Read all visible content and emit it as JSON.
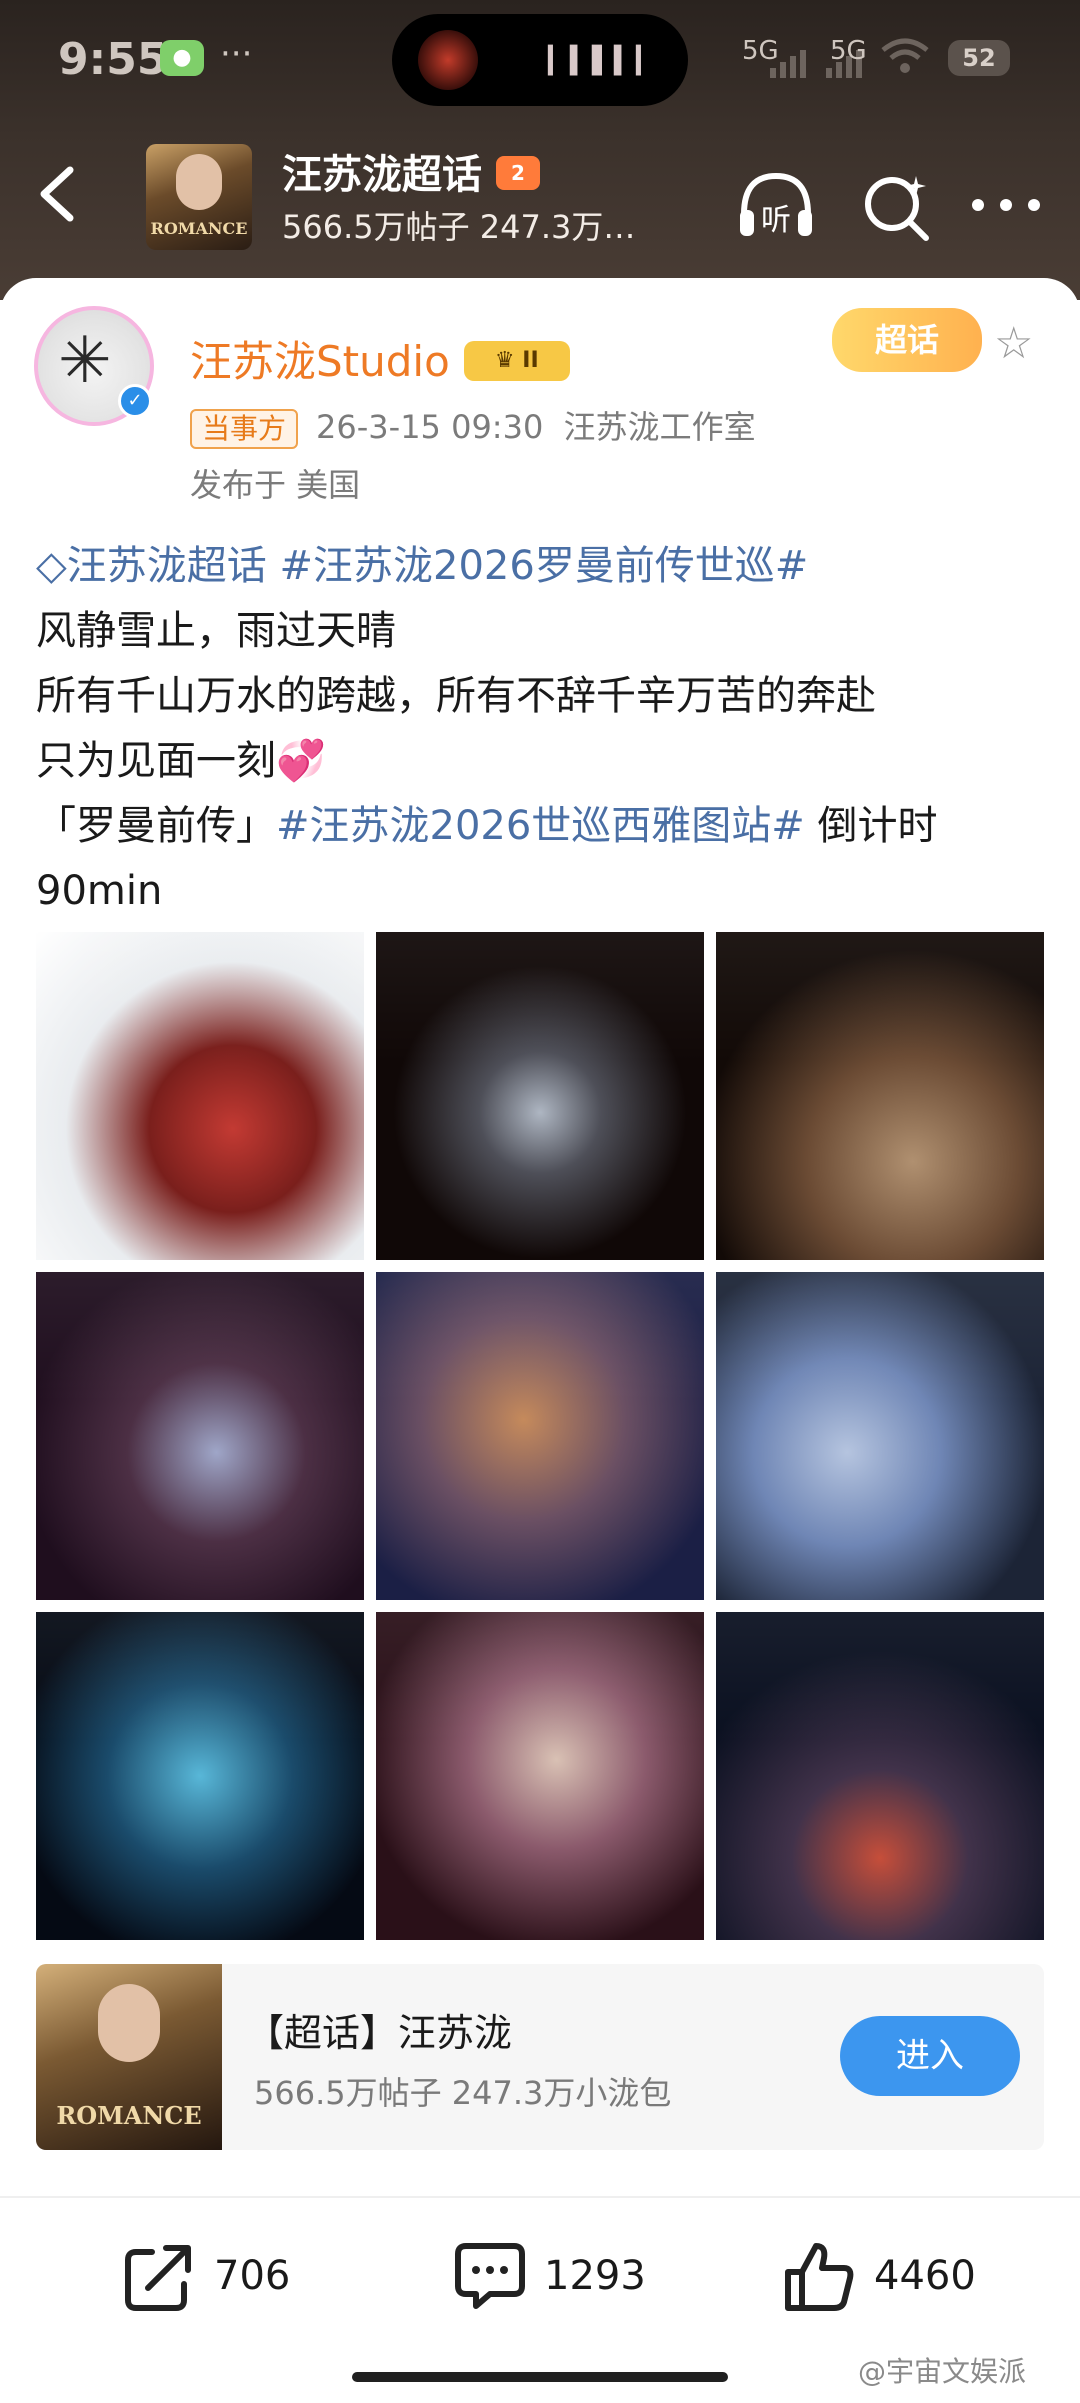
{
  "status_bar": {
    "time": "9:55",
    "dots": "···",
    "net1": "5G",
    "net2": "5G",
    "battery": "52"
  },
  "nav": {
    "title": "汪苏泷超话",
    "level": "2",
    "subtitle": "566.5万帖子 247.3万…",
    "listen_icon_text": "听",
    "avatar_logo": "ROMANCE"
  },
  "post": {
    "username": "汪苏泷Studio",
    "crown_label": "II",
    "supertopic_tag": "超话",
    "party_badge": "当事方",
    "timestamp": "26-3-15 09:30",
    "source": "汪苏泷工作室",
    "location": "发布于 美国",
    "line1_tag1": "汪苏泷超话",
    "line1_tag2": "#汪苏泷2026罗曼前传世巡#",
    "line2": "风静雪止，雨过天晴",
    "line3": "所有千山万水的跨越，所有不辞千辛万苦的奔赴",
    "line4": "只为见面一刻💞",
    "line5_pre": "「罗曼前传」",
    "line5_tag": "#汪苏泷2026世巡西雅图站#",
    "line5_post": " 倒计时",
    "line6": "90min"
  },
  "topic_card": {
    "title": "【超话】汪苏泷",
    "subtitle": "566.5万帖子 247.3万小泷包",
    "enter_label": "进入",
    "img_logo": "ROMANCE"
  },
  "actions": {
    "share_count": "706",
    "comment_count": "1293",
    "like_count": "4460"
  },
  "watermark": "@宇宙文娱派",
  "colors": {
    "username": "#ee7a25",
    "hashtag": "#4a6fa5",
    "enter_button": "#3c96ef"
  }
}
